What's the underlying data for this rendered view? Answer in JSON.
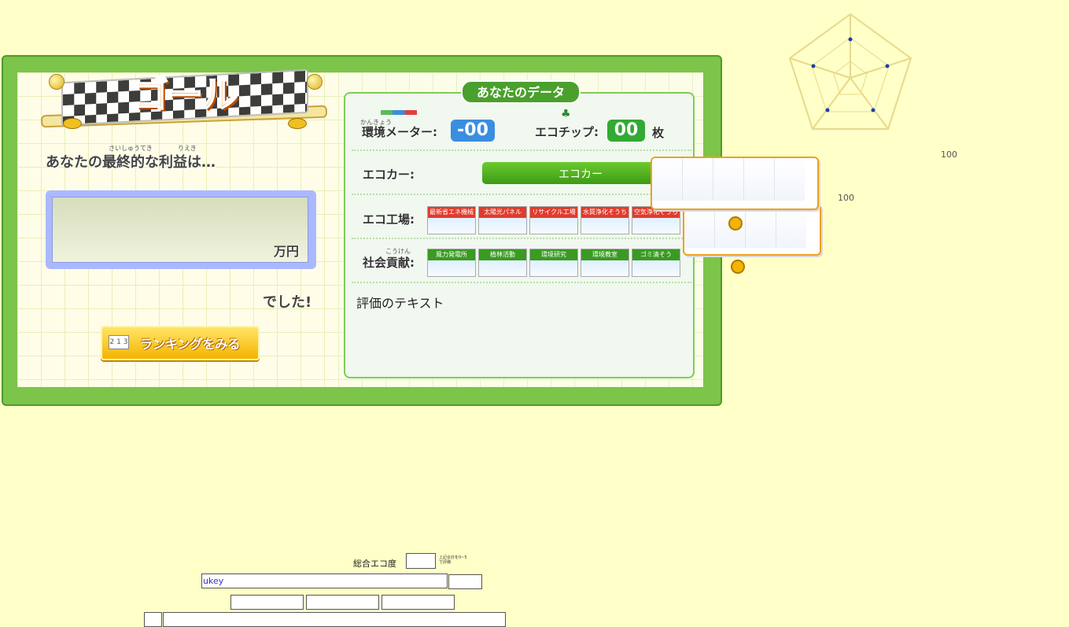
{
  "goal": {
    "title": "ゴール",
    "ruby_saishuteki": "さいしゅうてき",
    "ruby_rieki": "りえき",
    "question": "あなたの最終的な利益は…",
    "unit": "万円",
    "deshita": "でした!",
    "ranking_label": "ランキングをみる",
    "ranking_icon": "podium-icon"
  },
  "data": {
    "title": "あなたのデータ",
    "env_ruby": "かんきょう",
    "env_label": "環境メーター:",
    "env_value": "-00",
    "chip_label": "エコチップ:",
    "chip_value": "00",
    "chip_unit": "枚",
    "ecocar_label": "エコカー:",
    "ecocar_value": "エコカー",
    "factory_label": "エコ工場:",
    "factory_cards": [
      {
        "label": "最新省エネ機械",
        "color": "#e03c2c"
      },
      {
        "label": "太陽光パネル",
        "color": "#e03c2c"
      },
      {
        "label": "リサイクル工場",
        "color": "#e03c2c"
      },
      {
        "label": "水質浄化そうち",
        "color": "#e03c2c"
      },
      {
        "label": "空気浄化そうち",
        "color": "#e03c2c"
      }
    ],
    "social_ruby": "こうけん",
    "social_label": "社会貢献:",
    "social_cards": [
      {
        "label": "風力発電所",
        "color": "#3a9a22"
      },
      {
        "label": "植林活動",
        "color": "#3a9a22"
      },
      {
        "label": "環境研究",
        "color": "#3a9a22"
      },
      {
        "label": "環境教室",
        "color": "#3a9a22"
      },
      {
        "label": "ゴミ清そう",
        "color": "#3a9a22"
      }
    ],
    "eval_text": "評価のテキスト"
  },
  "radar": {
    "label_a": "100",
    "label_b": "100"
  },
  "form": {
    "total_label": "総合エコ度",
    "hint": "上記合計を0~5で評価",
    "ukey_value": "ukey"
  },
  "colors": {
    "panel_green": "#5fb535",
    "accent_orange": "#ff8c1a",
    "meter_blue": "#3a8ee0",
    "background": "#ffffc8"
  }
}
